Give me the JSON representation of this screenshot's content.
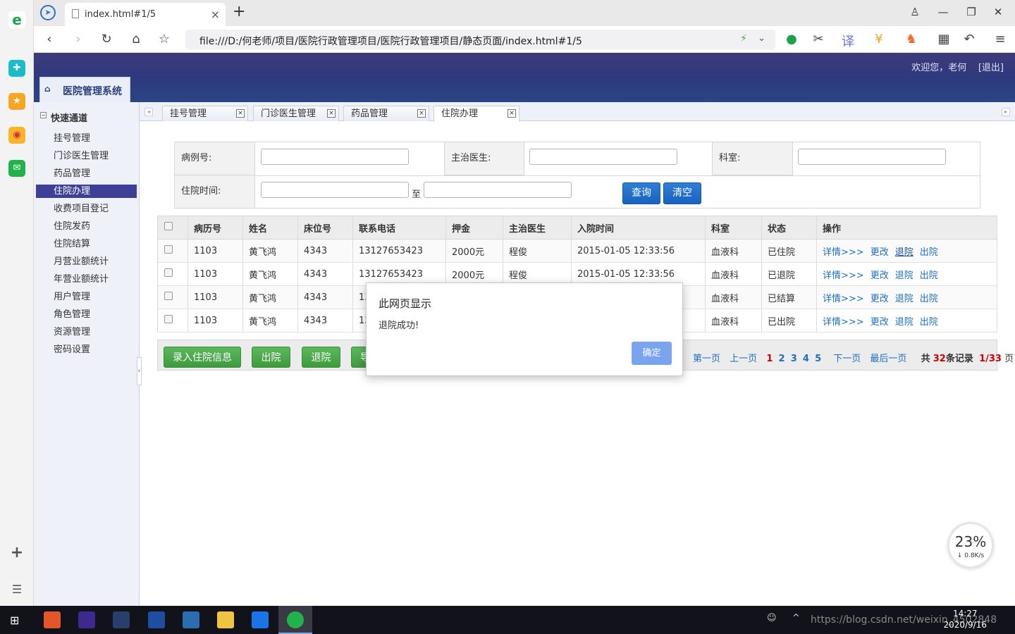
{
  "browser": {
    "tab_title": "index.html#1/5",
    "new_tab": "+",
    "close": "×",
    "url": "file:///D:/何老师/项目/医院行政管理项目/医院行政管理项目/静态页面/index.html#1/5",
    "window_controls": {
      "minimize": "—",
      "restore": "❐",
      "close": "✕"
    }
  },
  "header": {
    "welcome": "欢迎您，老何",
    "logout": "[退出]",
    "brand": "医院管理系统"
  },
  "sidebar": {
    "title": "快速通道",
    "items": [
      {
        "label": "挂号管理"
      },
      {
        "label": "门诊医生管理"
      },
      {
        "label": "药品管理"
      },
      {
        "label": "住院办理"
      },
      {
        "label": "收费项目登记"
      },
      {
        "label": "住院发药"
      },
      {
        "label": "住院结算"
      },
      {
        "label": "月营业额统计"
      },
      {
        "label": "年营业额统计"
      },
      {
        "label": "用户管理"
      },
      {
        "label": "角色管理"
      },
      {
        "label": "资源管理"
      },
      {
        "label": "密码设置"
      }
    ],
    "active_index": 3
  },
  "page_tabs": [
    {
      "label": "挂号管理"
    },
    {
      "label": "门诊医生管理"
    },
    {
      "label": "药品管理"
    },
    {
      "label": "住院办理"
    }
  ],
  "search": {
    "case_no_label": "病例号:",
    "doctor_label": "主治医生:",
    "dept_label": "科室:",
    "time_label": "住院时间:",
    "to_label": "至",
    "query_button": "查询",
    "clear_button": "清空"
  },
  "table": {
    "headers": [
      "病历号",
      "姓名",
      "床位号",
      "联系电话",
      "押金",
      "主治医生",
      "入院时间",
      "科室",
      "状态",
      "操作"
    ],
    "rows": [
      {
        "case": "1103",
        "name": "黄飞鸿",
        "bed": "4343",
        "phone": "13127653423",
        "deposit": "2000元",
        "doctor": "程俊",
        "time": "2015-01-05 12:33:56",
        "dept": "血液科",
        "status": "已住院"
      },
      {
        "case": "1103",
        "name": "黄飞鸿",
        "bed": "4343",
        "phone": "13127653423",
        "deposit": "2000元",
        "doctor": "程俊",
        "time": "2015-01-05 12:33:56",
        "dept": "血液科",
        "status": "已退院"
      },
      {
        "case": "1103",
        "name": "黄飞鸿",
        "bed": "4343",
        "phone": "13",
        "deposit": "",
        "doctor": "",
        "time": "",
        "dept": "血液科",
        "status": "已结算"
      },
      {
        "case": "1103",
        "name": "黄飞鸿",
        "bed": "4343",
        "phone": "13",
        "deposit": "",
        "doctor": "",
        "time": "",
        "dept": "血液科",
        "status": "已出院"
      }
    ],
    "ops": {
      "detail": "详情>>>",
      "edit": "更改",
      "discharge_back": "退院",
      "leave": "出院"
    }
  },
  "actions": {
    "add": "录入住院信息",
    "leave": "出院",
    "back": "退院",
    "export": "导"
  },
  "pager": {
    "first": "第一页",
    "prev": "上一页",
    "pages": [
      "1",
      "2",
      "3",
      "4",
      "5"
    ],
    "next": "下一页",
    "last": "最后一页",
    "total_prefix": "共",
    "total": "32",
    "total_suffix": "条记录",
    "current": "1/33",
    "page_suffix": "页"
  },
  "dialog": {
    "title": "此网页显示",
    "message": "退院成功!",
    "ok": "确定"
  },
  "speed_widget": {
    "percent": "23%",
    "rate": "↓ 0.8K/s"
  },
  "taskbar": {
    "time": "14:27",
    "date": "2020/9/16",
    "watermark": "https://blog.csdn.net/weixin_4502848"
  },
  "colors": {
    "header_bg": "#2e3a7d",
    "sidebar_active": "#3e3f96",
    "primary_button": "#1863be",
    "success_button": "#3d9a3d",
    "link": "#1d6fbf",
    "pager_red": "#d40000"
  }
}
